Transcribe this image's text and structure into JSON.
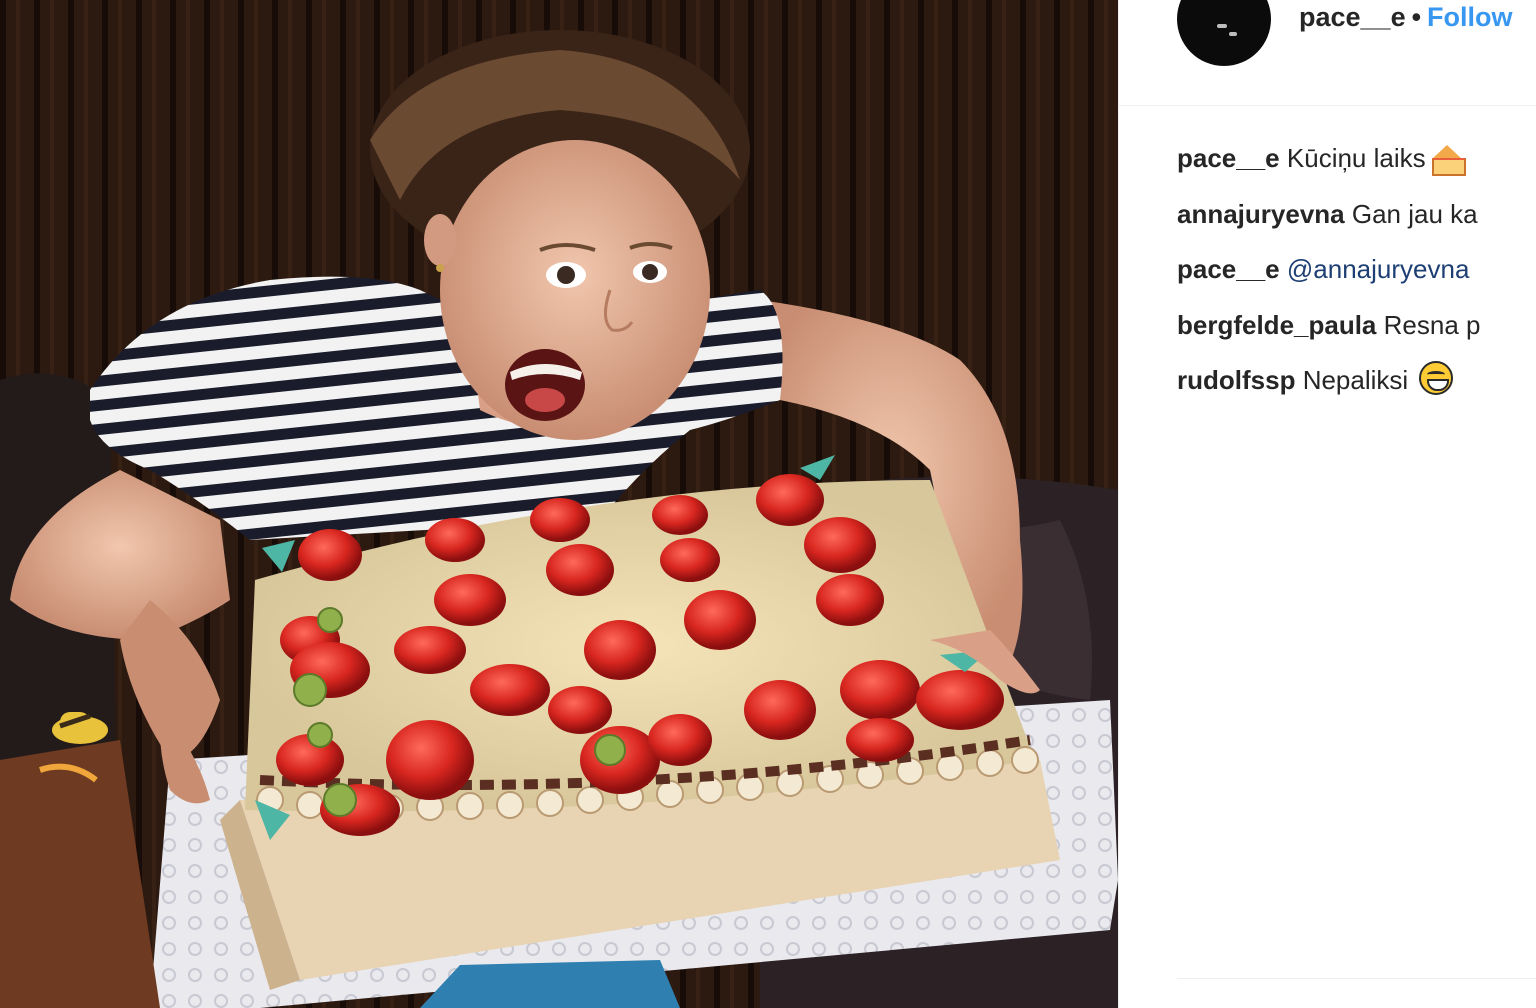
{
  "post": {
    "author": {
      "username": "pace__e",
      "separator": "•",
      "follow_label": "Follow"
    },
    "photo": {
      "subject": "woman in striped shirt with large strawberry cream cake"
    },
    "comments": [
      {
        "user": "pace__e",
        "text": "Kūciņu laiks",
        "emoji": "cake-icon"
      },
      {
        "user": "annajuryevna",
        "text": "Gan jau ka"
      },
      {
        "user": "pace__e",
        "mention": "@annajuryevna",
        "text": ""
      },
      {
        "user": "bergfelde_paula",
        "text": "Resna p"
      },
      {
        "user": "rudolfssp",
        "text": "Nepaliksi",
        "emoji": "grin-icon"
      }
    ]
  },
  "colors": {
    "follow": "#3897f0",
    "mention": "#1d3f73",
    "text": "#262626",
    "divider": "#efefef"
  }
}
